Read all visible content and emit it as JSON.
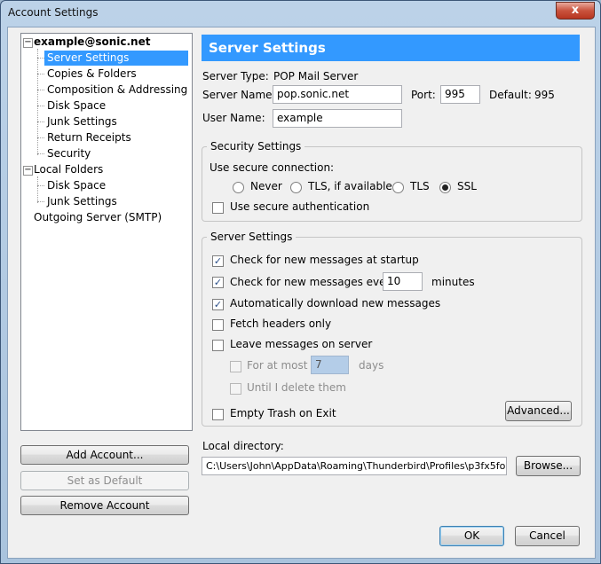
{
  "window": {
    "title": "Account Settings",
    "close_glyph": "x"
  },
  "tree": {
    "account": "example@sonic.net",
    "account_items": [
      "Server Settings",
      "Copies & Folders",
      "Composition & Addressing",
      "Disk Space",
      "Junk Settings",
      "Return Receipts",
      "Security"
    ],
    "local_folders": "Local Folders",
    "local_items": [
      "Disk Space",
      "Junk Settings"
    ],
    "outgoing": "Outgoing Server (SMTP)",
    "selected": "Server Settings",
    "collapse_glyph": "−"
  },
  "left_buttons": {
    "add_account": "Add Account...",
    "set_default": "Set as Default",
    "remove_account": "Remove Account"
  },
  "header": {
    "title": "Server Settings"
  },
  "server": {
    "type_label": "Server Type:",
    "type_value": "POP Mail Server",
    "name_label": "Server Name:",
    "name_value": "pop.sonic.net",
    "port_label": "Port:",
    "port_value": "995",
    "default_label": "Default:",
    "default_value": "995",
    "user_label": "User Name:",
    "user_value": "example"
  },
  "security": {
    "legend": "Security Settings",
    "use_secure": "Use secure connection:",
    "options": [
      "Never",
      "TLS, if available",
      "TLS",
      "SSL"
    ],
    "selected_option": "SSL",
    "secure_auth": "Use secure authentication"
  },
  "settings": {
    "legend": "Server Settings",
    "check_startup": "Check for new messages at startup",
    "check_every": "Check for new messages every",
    "minutes_value": "10",
    "minutes_label": "minutes",
    "auto_download": "Automatically download new messages",
    "fetch_headers": "Fetch headers only",
    "leave_messages": "Leave messages on server",
    "for_at_most": "For at most",
    "days_value": "7",
    "days_label": "days",
    "until_delete": "Until I delete them",
    "empty_trash": "Empty Trash on Exit",
    "advanced": "Advanced...",
    "check_glyph": "✓"
  },
  "local_dir": {
    "label": "Local directory:",
    "value": "C:\\Users\\John\\AppData\\Roaming\\Thunderbird\\Profiles\\p3fx5fo",
    "browse": "Browse..."
  },
  "footer": {
    "ok": "OK",
    "cancel": "Cancel"
  },
  "colors": {
    "selection": "#3399ff",
    "header_bg": "#3399ff",
    "dialog_bg": "#f0f0f0"
  }
}
